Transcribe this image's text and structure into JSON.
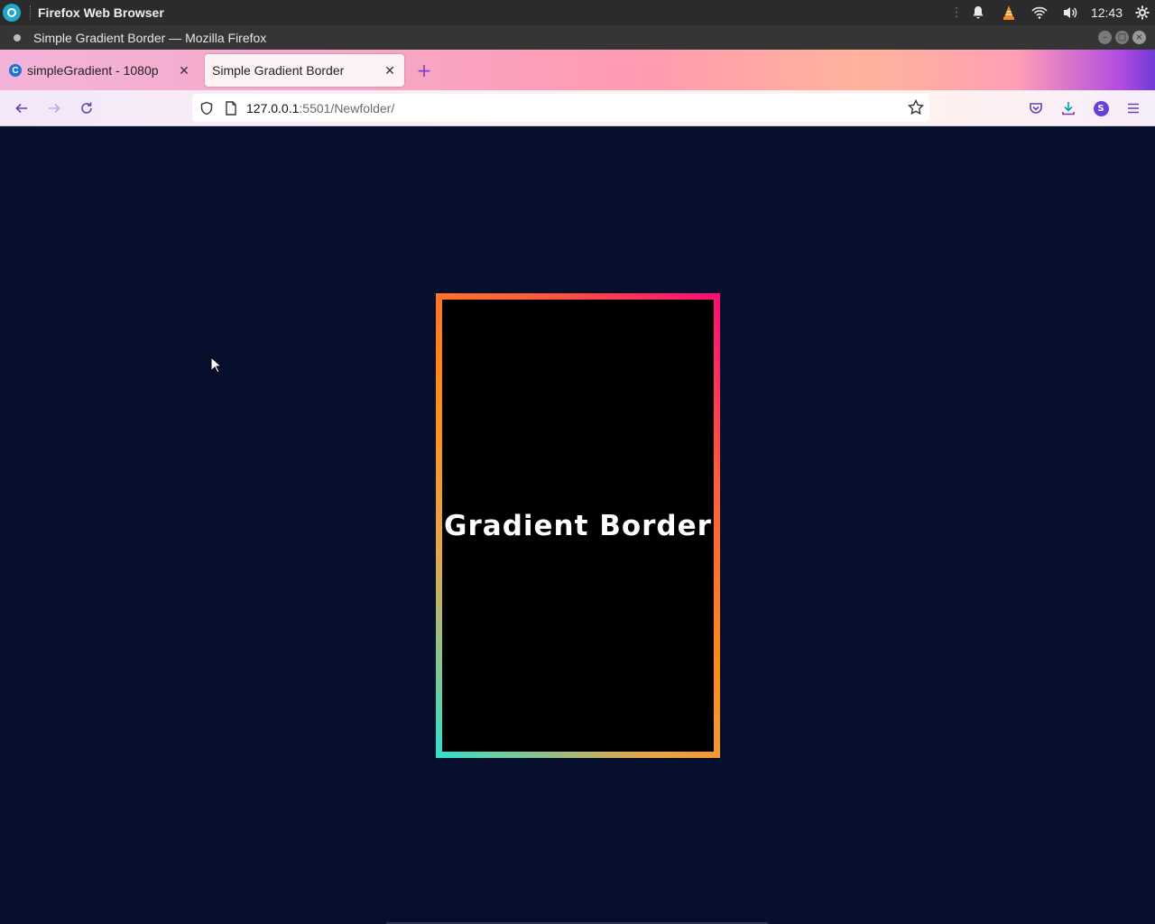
{
  "top_panel": {
    "app_name": "Firefox Web Browser",
    "clock": "12:43",
    "indicators": [
      "grip-icon",
      "notification-bell-icon",
      "vlc-icon",
      "wifi-icon",
      "volume-icon",
      "settings-icon"
    ]
  },
  "window": {
    "title": "Simple Gradient Border — Mozilla Firefox"
  },
  "tabs": [
    {
      "label": "simpleGradient - 1080p",
      "active": false,
      "favicon": "canva-icon"
    },
    {
      "label": "Simple Gradient Border",
      "active": true
    }
  ],
  "nav": {
    "url_host": "127.0.0.1",
    "url_rest": ":5501/Newfolder/",
    "profile_initial": "S"
  },
  "page": {
    "heading": "Gradient Border",
    "background": "#060f2c",
    "gradient_colors": [
      "#ff0b78",
      "#ff5b3a",
      "#ff8a18",
      "#e6a64a",
      "#2fe0d0"
    ]
  }
}
